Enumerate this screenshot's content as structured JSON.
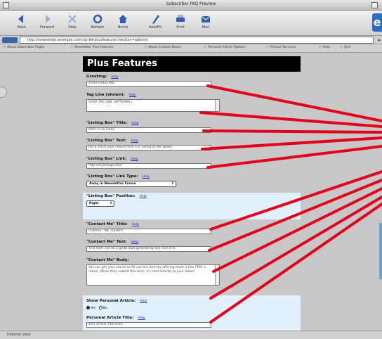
{
  "window": {
    "title": "Subscriber FAQ Preview"
  },
  "toolbar": {
    "buttons": [
      {
        "label": "Back",
        "icon": "back-arrow-icon"
      },
      {
        "label": "Forward",
        "icon": "forward-arrow-icon"
      },
      {
        "label": "Stop",
        "icon": "stop-icon"
      },
      {
        "label": "Refresh",
        "icon": "refresh-icon"
      },
      {
        "label": "Home",
        "icon": "home-icon"
      },
      {
        "label": "AutoFill",
        "icon": "autofill-icon"
      },
      {
        "label": "Print",
        "icon": "print-icon"
      },
      {
        "label": "Mail",
        "icon": "mail-icon"
      }
    ],
    "accent": "#2a6cc7"
  },
  "address": {
    "label": "Address",
    "url": "http://newsletter.example.com/cgi-bin/plusfeatures?section=options"
  },
  "favorites": [
    "About Subscriber Pages",
    "Newsletter Plus Features",
    "About Contact Boxes",
    "Personal Article Options",
    "Product Services",
    "Help",
    "Quit"
  ],
  "page": {
    "banner": "Plus Features",
    "help_label": "Help",
    "fields": {
      "greeting": {
        "label": "Greeting:",
        "value": "YOUR GREETING"
      },
      "tagline": {
        "label": "Tag Line (shown):",
        "value": "YOUR TAG LINE (OPTIONAL)"
      },
      "listing_title": {
        "label": "\"Listing Box\" Title:",
        "value": "Item TITLE HERE"
      },
      "listing_text": {
        "label": "\"Listing Box\" Text:",
        "value": "Put a list of your choice here (i.e. listing of the week)"
      },
      "listing_link": {
        "label": "\"Listing Box\" Link:",
        "value": "http://mylistings.com"
      },
      "listing_type": {
        "label": "\"Listing Box\" Link Type:",
        "value": "Away in Newsletter Frame"
      },
      "listing_position": {
        "label": "\"Listing Box\" Position:",
        "value": "Right"
      },
      "contact_title": {
        "label": "\"Contact Me\" Title:",
        "value": "CONTACT ME TODAY!!"
      },
      "contact_text": {
        "label": "\"Contact Me\" Text:",
        "value": "This form can be a great lead generating tool. Use it to"
      },
      "contact_body": {
        "label": "\"Contact Me\" Body:",
        "value": "You can get your clients to fill out this form by offering them a free CMA in return. When they submit this form, it's sent directly to your email!"
      },
      "personal_show": {
        "label": "Show Personal Article:",
        "yes": "Yes",
        "no": "No",
        "selected": "Yes"
      },
      "personal_title": {
        "label": "Personal Article Title:",
        "value": "Your Article Title Here"
      }
    }
  },
  "callouts": {
    "color": "#e3001b",
    "count": 10
  },
  "status": {
    "text": "Internet zone"
  }
}
